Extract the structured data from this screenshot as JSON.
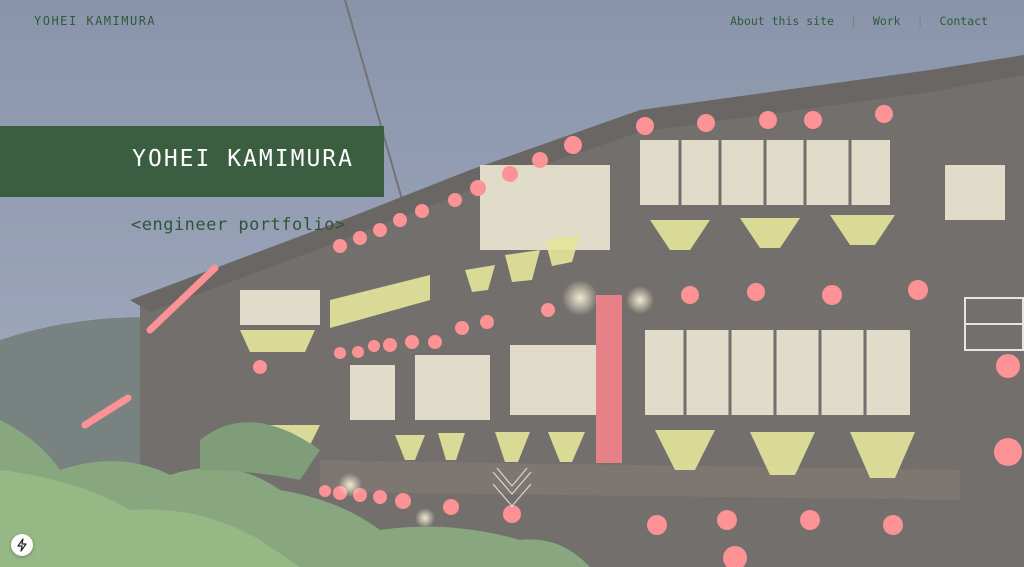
{
  "site": {
    "brand": "YOHEI KAMIMURA"
  },
  "nav": {
    "items": [
      "About this site",
      "Work",
      "Contact"
    ],
    "separator": "|"
  },
  "hero": {
    "title": "YOHEI KAMIMURA",
    "subtitle": "<engineer portfolio>",
    "image_icon": "teahouse-night-photo",
    "scroll_icon": "double-chevron-down-icon"
  },
  "footer_badge": {
    "icon": "lightning-icon"
  },
  "colors": {
    "accent": "#3b5e40",
    "text": "#2f5a3a",
    "lantern": "#e2474b",
    "light": "#f3eeb0"
  }
}
